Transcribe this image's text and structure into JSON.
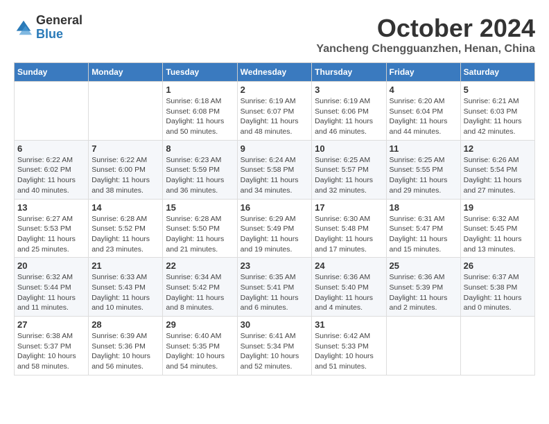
{
  "header": {
    "logo": {
      "line1": "General",
      "line2": "Blue"
    },
    "month": "October 2024",
    "location": "Yancheng Chengguanzhen, Henan, China"
  },
  "weekdays": [
    "Sunday",
    "Monday",
    "Tuesday",
    "Wednesday",
    "Thursday",
    "Friday",
    "Saturday"
  ],
  "weeks": [
    [
      {
        "day": "",
        "text": ""
      },
      {
        "day": "",
        "text": ""
      },
      {
        "day": "1",
        "text": "Sunrise: 6:18 AM\nSunset: 6:08 PM\nDaylight: 11 hours and 50 minutes."
      },
      {
        "day": "2",
        "text": "Sunrise: 6:19 AM\nSunset: 6:07 PM\nDaylight: 11 hours and 48 minutes."
      },
      {
        "day": "3",
        "text": "Sunrise: 6:19 AM\nSunset: 6:06 PM\nDaylight: 11 hours and 46 minutes."
      },
      {
        "day": "4",
        "text": "Sunrise: 6:20 AM\nSunset: 6:04 PM\nDaylight: 11 hours and 44 minutes."
      },
      {
        "day": "5",
        "text": "Sunrise: 6:21 AM\nSunset: 6:03 PM\nDaylight: 11 hours and 42 minutes."
      }
    ],
    [
      {
        "day": "6",
        "text": "Sunrise: 6:22 AM\nSunset: 6:02 PM\nDaylight: 11 hours and 40 minutes."
      },
      {
        "day": "7",
        "text": "Sunrise: 6:22 AM\nSunset: 6:00 PM\nDaylight: 11 hours and 38 minutes."
      },
      {
        "day": "8",
        "text": "Sunrise: 6:23 AM\nSunset: 5:59 PM\nDaylight: 11 hours and 36 minutes."
      },
      {
        "day": "9",
        "text": "Sunrise: 6:24 AM\nSunset: 5:58 PM\nDaylight: 11 hours and 34 minutes."
      },
      {
        "day": "10",
        "text": "Sunrise: 6:25 AM\nSunset: 5:57 PM\nDaylight: 11 hours and 32 minutes."
      },
      {
        "day": "11",
        "text": "Sunrise: 6:25 AM\nSunset: 5:55 PM\nDaylight: 11 hours and 29 minutes."
      },
      {
        "day": "12",
        "text": "Sunrise: 6:26 AM\nSunset: 5:54 PM\nDaylight: 11 hours and 27 minutes."
      }
    ],
    [
      {
        "day": "13",
        "text": "Sunrise: 6:27 AM\nSunset: 5:53 PM\nDaylight: 11 hours and 25 minutes."
      },
      {
        "day": "14",
        "text": "Sunrise: 6:28 AM\nSunset: 5:52 PM\nDaylight: 11 hours and 23 minutes."
      },
      {
        "day": "15",
        "text": "Sunrise: 6:28 AM\nSunset: 5:50 PM\nDaylight: 11 hours and 21 minutes."
      },
      {
        "day": "16",
        "text": "Sunrise: 6:29 AM\nSunset: 5:49 PM\nDaylight: 11 hours and 19 minutes."
      },
      {
        "day": "17",
        "text": "Sunrise: 6:30 AM\nSunset: 5:48 PM\nDaylight: 11 hours and 17 minutes."
      },
      {
        "day": "18",
        "text": "Sunrise: 6:31 AM\nSunset: 5:47 PM\nDaylight: 11 hours and 15 minutes."
      },
      {
        "day": "19",
        "text": "Sunrise: 6:32 AM\nSunset: 5:45 PM\nDaylight: 11 hours and 13 minutes."
      }
    ],
    [
      {
        "day": "20",
        "text": "Sunrise: 6:32 AM\nSunset: 5:44 PM\nDaylight: 11 hours and 11 minutes."
      },
      {
        "day": "21",
        "text": "Sunrise: 6:33 AM\nSunset: 5:43 PM\nDaylight: 11 hours and 10 minutes."
      },
      {
        "day": "22",
        "text": "Sunrise: 6:34 AM\nSunset: 5:42 PM\nDaylight: 11 hours and 8 minutes."
      },
      {
        "day": "23",
        "text": "Sunrise: 6:35 AM\nSunset: 5:41 PM\nDaylight: 11 hours and 6 minutes."
      },
      {
        "day": "24",
        "text": "Sunrise: 6:36 AM\nSunset: 5:40 PM\nDaylight: 11 hours and 4 minutes."
      },
      {
        "day": "25",
        "text": "Sunrise: 6:36 AM\nSunset: 5:39 PM\nDaylight: 11 hours and 2 minutes."
      },
      {
        "day": "26",
        "text": "Sunrise: 6:37 AM\nSunset: 5:38 PM\nDaylight: 11 hours and 0 minutes."
      }
    ],
    [
      {
        "day": "27",
        "text": "Sunrise: 6:38 AM\nSunset: 5:37 PM\nDaylight: 10 hours and 58 minutes."
      },
      {
        "day": "28",
        "text": "Sunrise: 6:39 AM\nSunset: 5:36 PM\nDaylight: 10 hours and 56 minutes."
      },
      {
        "day": "29",
        "text": "Sunrise: 6:40 AM\nSunset: 5:35 PM\nDaylight: 10 hours and 54 minutes."
      },
      {
        "day": "30",
        "text": "Sunrise: 6:41 AM\nSunset: 5:34 PM\nDaylight: 10 hours and 52 minutes."
      },
      {
        "day": "31",
        "text": "Sunrise: 6:42 AM\nSunset: 5:33 PM\nDaylight: 10 hours and 51 minutes."
      },
      {
        "day": "",
        "text": ""
      },
      {
        "day": "",
        "text": ""
      }
    ]
  ]
}
